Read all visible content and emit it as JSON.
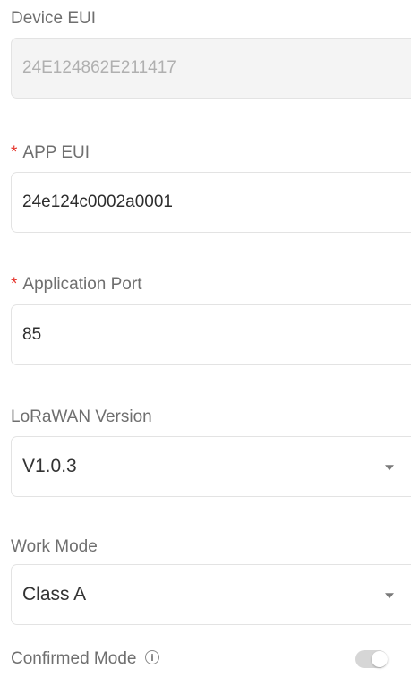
{
  "device_eui": {
    "label": "Device EUI",
    "value": "24E124862E211417"
  },
  "app_eui": {
    "required_mark": "*",
    "label": "APP EUI",
    "value": "24e124c0002a0001"
  },
  "application_port": {
    "required_mark": "*",
    "label": "Application Port",
    "value": "85"
  },
  "lorawan_version": {
    "label": "LoRaWAN Version",
    "selected": "V1.0.3"
  },
  "work_mode": {
    "label": "Work Mode",
    "selected": "Class A"
  },
  "confirmed_mode": {
    "label": "Confirmed Mode",
    "toggle_on": false
  },
  "colors": {
    "required": "#e5332a",
    "label": "#6f6f6f",
    "toggle_off": "#d6d6d6"
  }
}
